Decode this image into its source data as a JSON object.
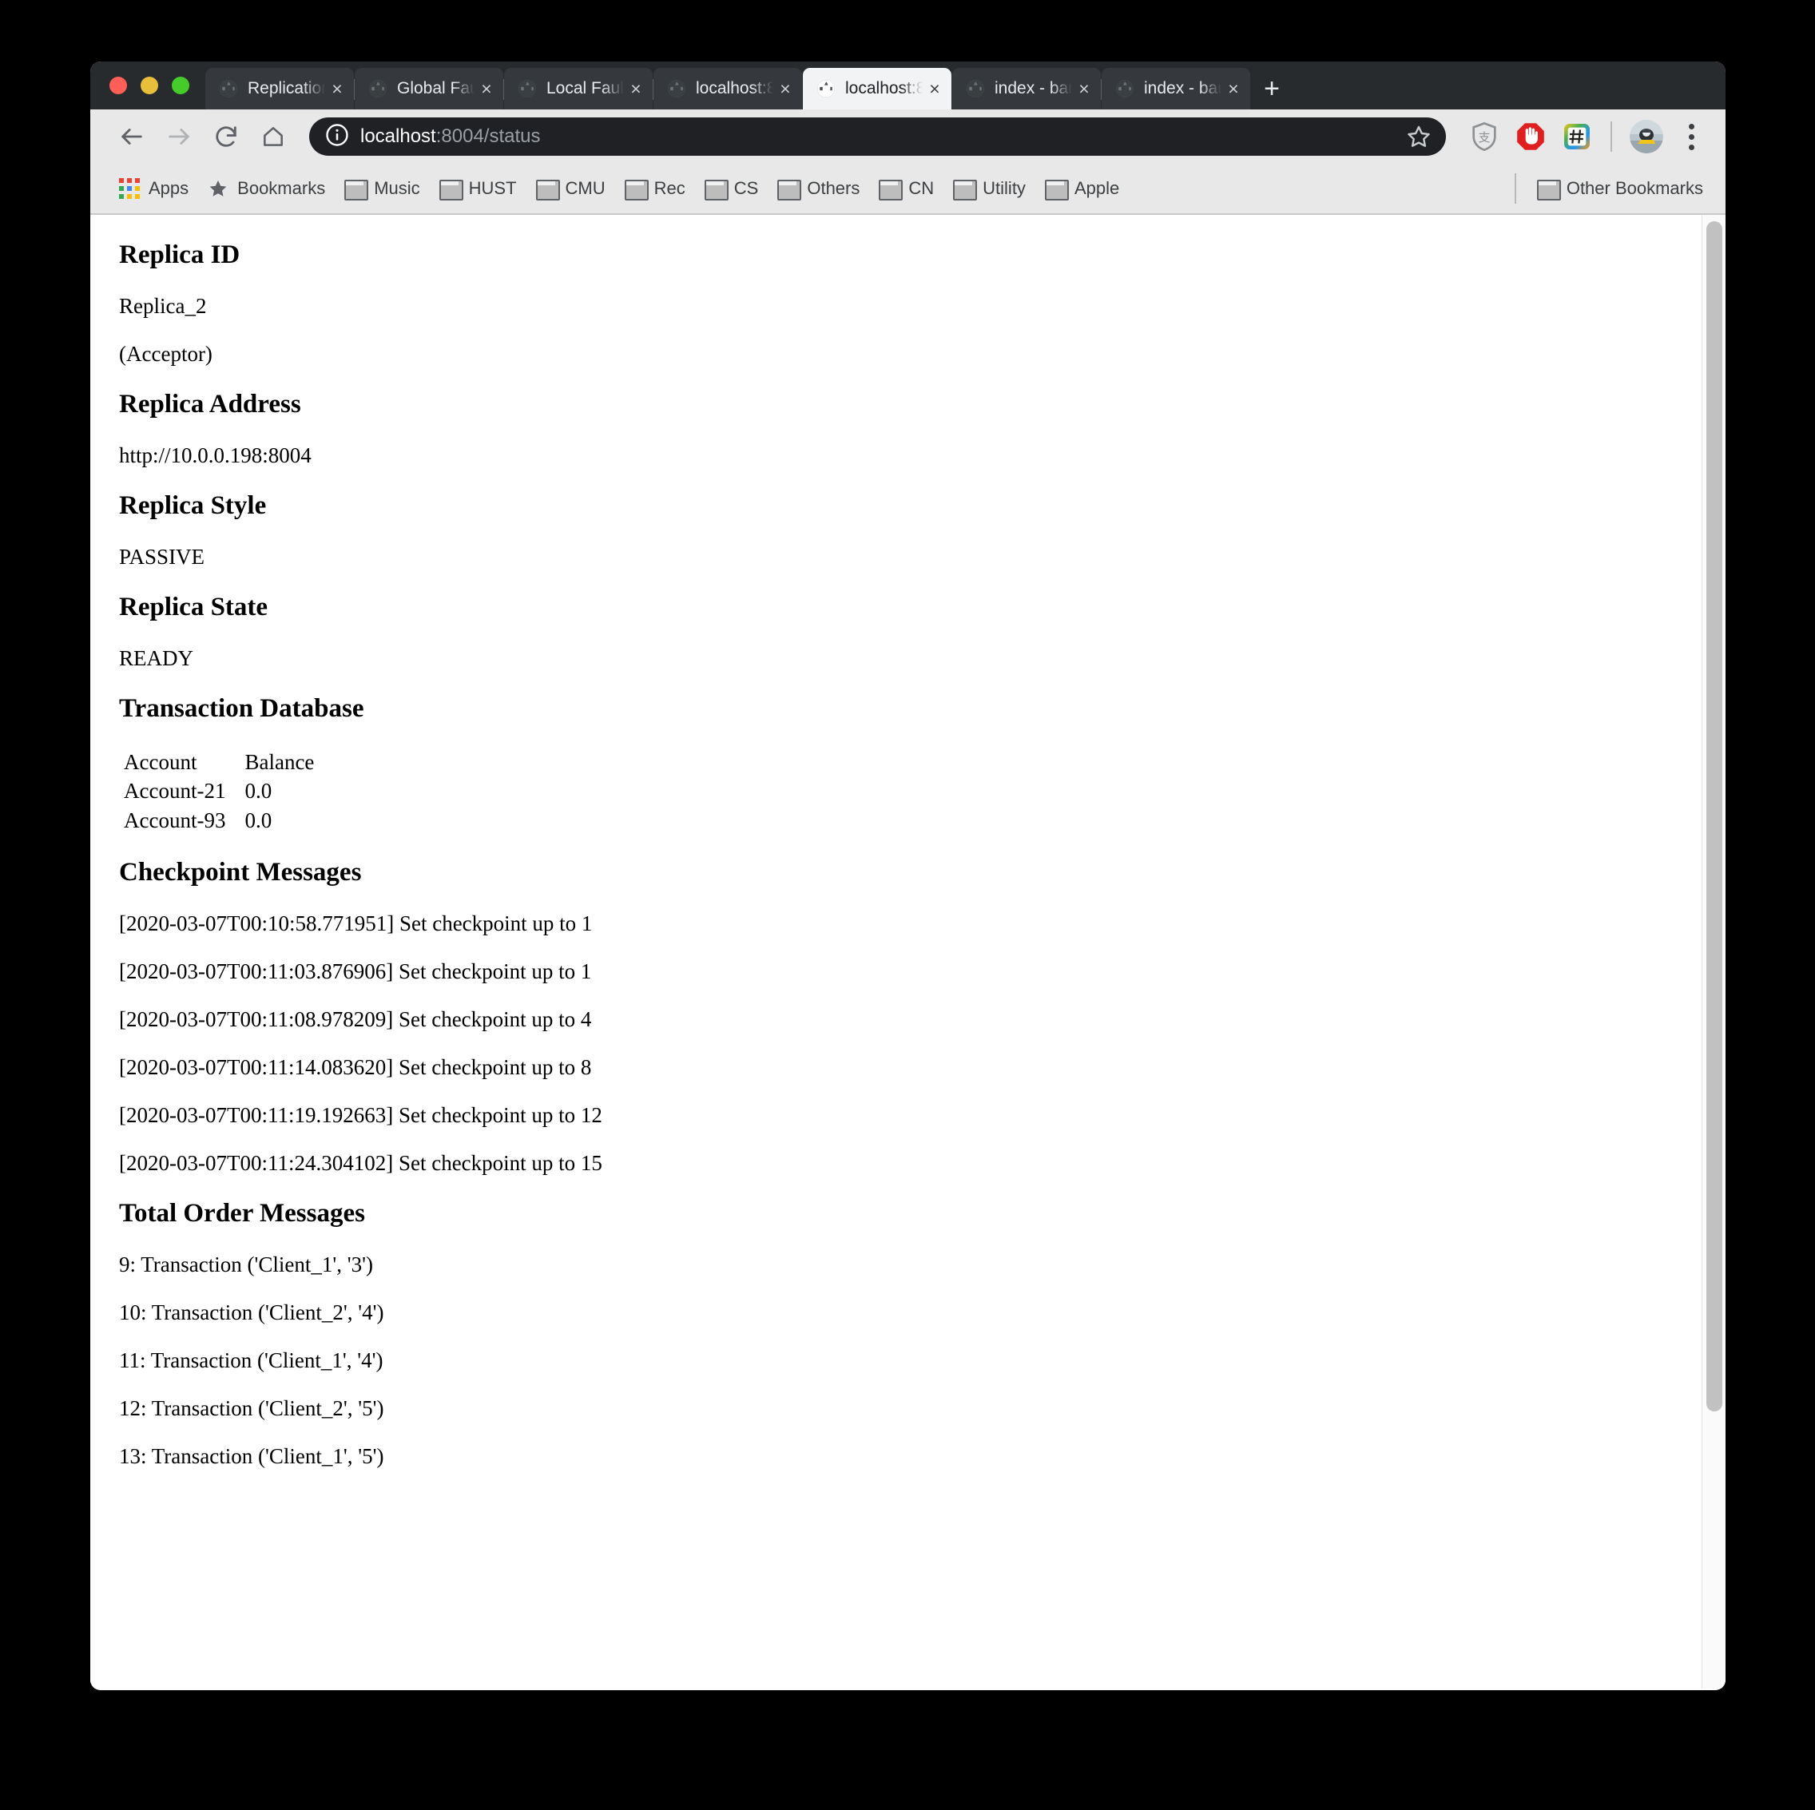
{
  "window": {
    "traffic_lights": [
      "close",
      "minimize",
      "maximize"
    ]
  },
  "tabs": [
    {
      "title": "Replication",
      "favicon": "globe-icon",
      "close": "×",
      "active": false
    },
    {
      "title": "Global Fault",
      "favicon": "globe-icon",
      "close": "×",
      "active": false
    },
    {
      "title": "Local Fault",
      "favicon": "globe-icon",
      "close": "×",
      "active": false
    },
    {
      "title": "localhost:8",
      "favicon": "globe-icon",
      "close": "×",
      "active": false
    },
    {
      "title": "localhost:8",
      "favicon": "globe-icon",
      "close": "×",
      "active": true
    },
    {
      "title": "index - bank",
      "favicon": "globe-icon",
      "close": "×",
      "active": false
    },
    {
      "title": "index - bank",
      "favicon": "globe-icon",
      "close": "×",
      "active": false
    }
  ],
  "new_tab_label": "+",
  "toolbar": {
    "back_icon": "back-arrow-icon",
    "forward_icon": "forward-arrow-icon",
    "reload_icon": "reload-icon",
    "home_icon": "home-icon",
    "info_icon": "info-circle-icon",
    "url_host": "localhost",
    "url_path": ":8004/status",
    "url_full": "localhost:8004/status",
    "bookmark_icon": "star-outline-icon",
    "extensions": [
      {
        "name": "alipay-shield-icon"
      },
      {
        "name": "adblock-stop-hand-icon"
      },
      {
        "name": "hashtag-note-icon"
      }
    ],
    "avatar": "profile-avatar",
    "menu_icon": "three-dot-menu-icon"
  },
  "bookmarks": {
    "apps_label": "Apps",
    "apps_icon": "apps-grid-icon",
    "items": [
      {
        "label": "Bookmarks",
        "icon": "star-filled-icon"
      },
      {
        "label": "Music",
        "icon": "folder-icon"
      },
      {
        "label": "HUST",
        "icon": "folder-icon"
      },
      {
        "label": "CMU",
        "icon": "folder-icon"
      },
      {
        "label": "Rec",
        "icon": "folder-icon"
      },
      {
        "label": "CS",
        "icon": "folder-icon"
      },
      {
        "label": "Others",
        "icon": "folder-icon"
      },
      {
        "label": "CN",
        "icon": "folder-icon"
      },
      {
        "label": "Utility",
        "icon": "folder-icon"
      },
      {
        "label": "Apple",
        "icon": "folder-icon"
      }
    ],
    "other_label": "Other Bookmarks",
    "other_icon": "folder-icon"
  },
  "page": {
    "replica_id_heading": "Replica ID",
    "replica_id_value": "Replica_2",
    "replica_role": "(Acceptor)",
    "replica_address_heading": "Replica Address",
    "replica_address_value": "http://10.0.0.198:8004",
    "replica_style_heading": "Replica Style",
    "replica_style_value": "PASSIVE",
    "replica_state_heading": "Replica State",
    "replica_state_value": "READY",
    "transaction_db_heading": "Transaction Database",
    "transaction_db": {
      "columns": [
        "Account",
        "Balance"
      ],
      "rows": [
        [
          "Account-21",
          "0.0"
        ],
        [
          "Account-93",
          "0.0"
        ]
      ]
    },
    "checkpoint_heading": "Checkpoint Messages",
    "checkpoint_messages": [
      "[2020-03-07T00:10:58.771951] Set checkpoint up to 1",
      "[2020-03-07T00:11:03.876906] Set checkpoint up to 1",
      "[2020-03-07T00:11:08.978209] Set checkpoint up to 4",
      "[2020-03-07T00:11:14.083620] Set checkpoint up to 8",
      "[2020-03-07T00:11:19.192663] Set checkpoint up to 12",
      "[2020-03-07T00:11:24.304102] Set checkpoint up to 15"
    ],
    "total_order_heading": "Total Order Messages",
    "total_order_messages": [
      "9: Transaction ('Client_1', '3')",
      "10: Transaction ('Client_2', '4')",
      "11: Transaction ('Client_1', '4')",
      "12: Transaction ('Client_2', '5')",
      "13: Transaction ('Client_1', '5')"
    ]
  },
  "colors": {
    "tabstrip_bg": "#272b2e",
    "tab_inactive_bg": "#35393d",
    "tab_active_bg": "#f1f3f4",
    "toolbar_bg": "#e8e8e8",
    "omnibox_bg": "#1f2124",
    "page_bg": "#ffffff",
    "scrollbar_thumb": "#c1c1c1"
  }
}
